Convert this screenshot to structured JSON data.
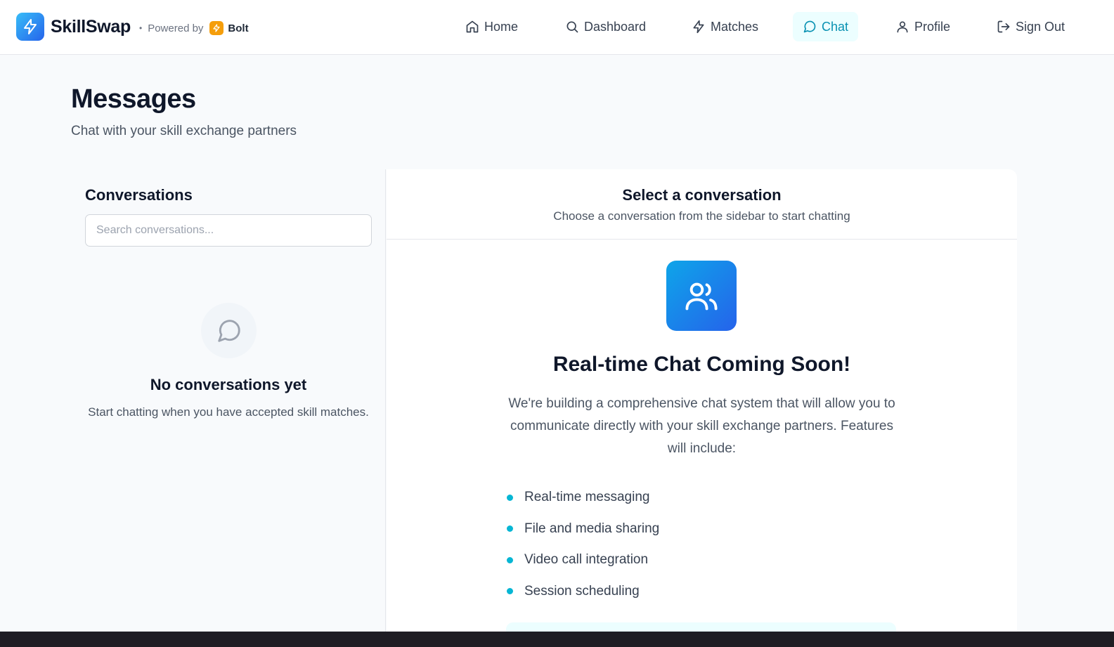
{
  "header": {
    "brand": "SkillSwap",
    "powered_by": "Powered by",
    "bolt": "Bolt",
    "nav": [
      {
        "label": "Home",
        "icon": "home-icon"
      },
      {
        "label": "Dashboard",
        "icon": "search-icon"
      },
      {
        "label": "Matches",
        "icon": "lightning-icon"
      },
      {
        "label": "Chat",
        "icon": "message-circle-icon",
        "active": true
      },
      {
        "label": "Profile",
        "icon": "user-icon"
      },
      {
        "label": "Sign Out",
        "icon": "logout-icon"
      }
    ]
  },
  "page": {
    "title": "Messages",
    "subtitle": "Chat with your skill exchange partners"
  },
  "sidebar": {
    "title": "Conversations",
    "search_placeholder": "Search conversations...",
    "empty_title": "No conversations yet",
    "empty_sub": "Start chatting when you have accepted skill matches."
  },
  "main": {
    "head_title": "Select a conversation",
    "head_sub": "Choose a conversation from the sidebar to start chatting",
    "soon_title": "Real-time Chat Coming Soon!",
    "soon_desc": "We're building a comprehensive chat system that will allow you to communicate directly with your skill exchange partners. Features will include:",
    "features": [
      "Real-time messaging",
      "File and media sharing",
      "Video call integration",
      "Session scheduling"
    ]
  },
  "colors": {
    "accent": "#0891b2",
    "accent_bg": "#ecfeff",
    "bullet": "#06b6d4",
    "brand_gradient_start": "#0ea5e9",
    "brand_gradient_end": "#2563eb",
    "bolt_badge": "#f59e0b"
  }
}
